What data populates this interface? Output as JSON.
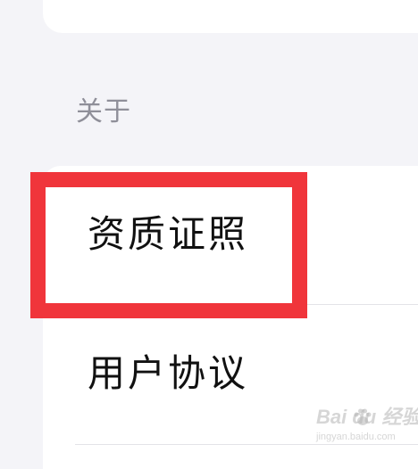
{
  "section": {
    "header": "关于"
  },
  "items": [
    {
      "label": "资质证照"
    },
    {
      "label": "用户协议"
    }
  ],
  "annotation": {
    "color": "#f0353b"
  },
  "watermark": {
    "logo_text": "Bai du 经验",
    "url": "jingyan.baidu.com"
  }
}
